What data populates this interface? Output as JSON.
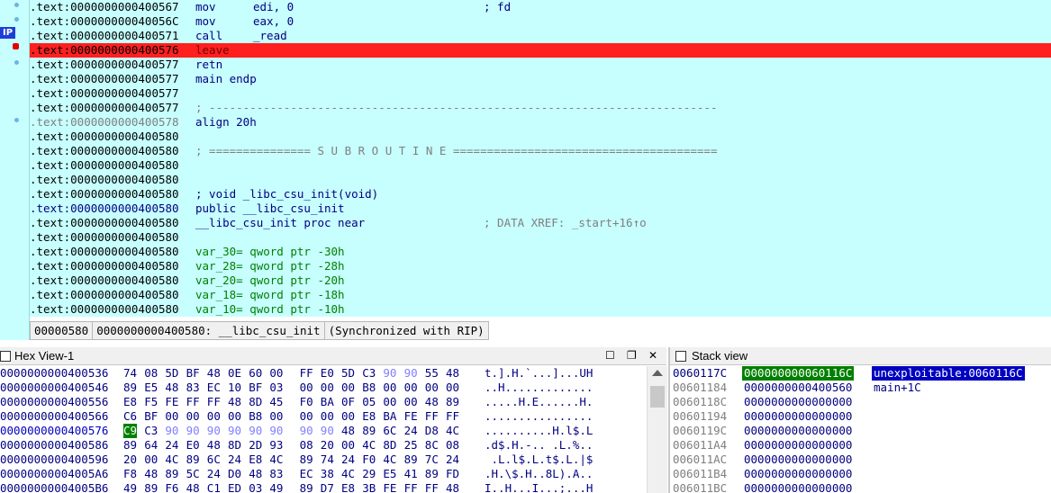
{
  "disasm": {
    "ip_label": "IP",
    "lines": [
      {
        "addr": ".text:0000000000400567",
        "ins": "mov",
        "ops": "edi, 0",
        "comment": "; fd"
      },
      {
        "addr": ".text:000000000040056C",
        "ins": "mov",
        "ops": "eax, 0",
        "comment": ""
      },
      {
        "addr": ".text:0000000000400571",
        "ins": "call",
        "ops": "_read",
        "comment": ""
      },
      {
        "addr": ".text:0000000000400576",
        "ins": "leave",
        "ops": "",
        "comment": ""
      },
      {
        "addr": ".text:0000000000400577",
        "ins": "retn",
        "ops": "",
        "comment": ""
      },
      {
        "addr": ".text:0000000000400577",
        "ins": "main endp",
        "ops": "",
        "comment": ""
      },
      {
        "addr": ".text:0000000000400577",
        "ins": "",
        "ops": "",
        "comment": ""
      },
      {
        "addr": ".text:0000000000400577",
        "ins": "",
        "ops": "",
        "comment": "; ---------------------------------------------------------------------------"
      },
      {
        "addr": ".text:0000000000400578",
        "ins": "align 20h",
        "ops": "",
        "comment": ""
      },
      {
        "addr": ".text:0000000000400580",
        "ins": "",
        "ops": "",
        "comment": ""
      },
      {
        "addr": ".text:0000000000400580",
        "ins": "",
        "ops": "",
        "comment": "; =============== S U B R O U T I N E ======================================="
      },
      {
        "addr": ".text:0000000000400580",
        "ins": "",
        "ops": "",
        "comment": ""
      },
      {
        "addr": ".text:0000000000400580",
        "ins": "",
        "ops": "",
        "comment": ""
      },
      {
        "addr": ".text:0000000000400580",
        "ins": "; void _libc_csu_init(void)",
        "ops": "",
        "comment": ""
      },
      {
        "addr": ".text:0000000000400580",
        "ins": "public __libc_csu_init",
        "ops": "",
        "comment": ""
      },
      {
        "addr": ".text:0000000000400580",
        "ins": "__libc_csu_init proc near",
        "ops": "",
        "comment": "; DATA XREF: _start+16↑o"
      },
      {
        "addr": ".text:0000000000400580",
        "ins": "",
        "ops": "",
        "comment": ""
      },
      {
        "addr": ".text:0000000000400580",
        "ins": "var_30= qword ptr -30h",
        "ops": "",
        "comment": ""
      },
      {
        "addr": ".text:0000000000400580",
        "ins": "var_28= qword ptr -28h",
        "ops": "",
        "comment": ""
      },
      {
        "addr": ".text:0000000000400580",
        "ins": "var_20= qword ptr -20h",
        "ops": "",
        "comment": ""
      },
      {
        "addr": ".text:0000000000400580",
        "ins": "var_18= qword ptr -18h",
        "ops": "",
        "comment": ""
      },
      {
        "addr": ".text:0000000000400580",
        "ins": "var_10= qword ptr -10h",
        "ops": "",
        "comment": ""
      }
    ],
    "status": {
      "offset": "00000580",
      "location": "0000000000400580: __libc_csu_init",
      "sync": "(Synchronized with RIP)"
    }
  },
  "hex_view": {
    "title": "Hex View-1",
    "rows": [
      {
        "addr": "0000000000400536",
        "bytes": [
          "74",
          "08",
          "5D",
          "BF",
          "48",
          "0E",
          "60",
          "00",
          "FF",
          "E0",
          "5D",
          "C3",
          "90",
          "90",
          "55",
          "48"
        ],
        "ascii": "t.].H.`...]...UH"
      },
      {
        "addr": "0000000000400546",
        "bytes": [
          "89",
          "E5",
          "48",
          "83",
          "EC",
          "10",
          "BF",
          "03",
          "00",
          "00",
          "00",
          "B8",
          "00",
          "00",
          "00",
          "00"
        ],
        "ascii": "..H............."
      },
      {
        "addr": "0000000000400556",
        "bytes": [
          "E8",
          "F5",
          "FE",
          "FF",
          "FF",
          "48",
          "8D",
          "45",
          "F0",
          "BA",
          "0F",
          "05",
          "00",
          "00",
          "48",
          "89"
        ],
        "ascii": ".....H.E......H."
      },
      {
        "addr": "0000000000400566",
        "bytes": [
          "C6",
          "BF",
          "00",
          "00",
          "00",
          "00",
          "B8",
          "00",
          "00",
          "00",
          "00",
          "E8",
          "BA",
          "FE",
          "FF",
          "FF"
        ],
        "ascii": "................"
      },
      {
        "addr": "0000000000400576",
        "bytes": [
          "C9",
          "C3",
          "90",
          "90",
          "90",
          "90",
          "90",
          "90",
          "90",
          "90",
          "48",
          "89",
          "6C",
          "24",
          "D8",
          "4C"
        ],
        "ascii": "..........H.l$.L"
      },
      {
        "addr": "0000000000400586",
        "bytes": [
          "89",
          "64",
          "24",
          "E0",
          "48",
          "8D",
          "2D",
          "93",
          "08",
          "20",
          "00",
          "4C",
          "8D",
          "25",
          "8C",
          "08"
        ],
        "ascii": ".d$.H.-.. .L.%.."
      },
      {
        "addr": "0000000000400596",
        "bytes": [
          "20",
          "00",
          "4C",
          "89",
          "6C",
          "24",
          "E8",
          "4C",
          "89",
          "74",
          "24",
          "F0",
          "4C",
          "89",
          "7C",
          "24"
        ],
        "ascii": " .L.l$.L.t$.L.|$"
      },
      {
        "addr": "00000000004005A6",
        "bytes": [
          "F8",
          "48",
          "89",
          "5C",
          "24",
          "D0",
          "48",
          "83",
          "EC",
          "38",
          "4C",
          "29",
          "E5",
          "41",
          "89",
          "FD"
        ],
        "ascii": ".H.\\$.H..8L).A.."
      },
      {
        "addr": "00000000004005B6",
        "bytes": [
          "49",
          "89",
          "F6",
          "48",
          "C1",
          "ED",
          "03",
          "49",
          "89",
          "D7",
          "E8",
          "3B",
          "FE",
          "FF",
          "FF",
          "48"
        ],
        "ascii": "I..H...I...;...H"
      }
    ]
  },
  "stack_view": {
    "title": "Stack view",
    "rows": [
      {
        "addr": "0060117C",
        "value": "000000000060116C",
        "ref": "unexploitable:0060116C"
      },
      {
        "addr": "00601184",
        "value": "0000000000400560",
        "ref": "main+1C"
      },
      {
        "addr": "0060118C",
        "value": "0000000000000000",
        "ref": ""
      },
      {
        "addr": "00601194",
        "value": "0000000000000000",
        "ref": ""
      },
      {
        "addr": "0060119C",
        "value": "0000000000000000",
        "ref": ""
      },
      {
        "addr": "006011A4",
        "value": "0000000000000000",
        "ref": ""
      },
      {
        "addr": "006011AC",
        "value": "0000000000000000",
        "ref": ""
      },
      {
        "addr": "006011B4",
        "value": "0000000000000000",
        "ref": ""
      },
      {
        "addr": "006011BC",
        "value": "0000000000000000",
        "ref": ""
      }
    ]
  },
  "colors": {
    "listing_bg": "#c7fefe",
    "current_line": "#ff1f1f",
    "selection_green": "#008000",
    "selection_blue": "#0000c0"
  }
}
